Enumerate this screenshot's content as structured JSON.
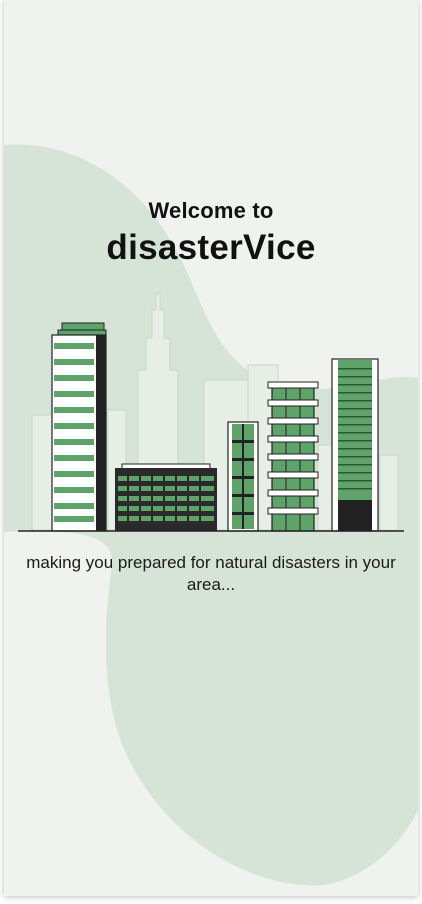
{
  "welcome": {
    "greeting": "Welcome to",
    "app_name": "disasterVice",
    "tagline": "making you prepared for natural disasters in your area..."
  },
  "illustration": {
    "icon": "city-skyline-illustration"
  },
  "colors": {
    "background": "#f0f2ef",
    "blob": "#d6e4d7",
    "accent_green": "#5fa36a",
    "dark": "#222222"
  }
}
